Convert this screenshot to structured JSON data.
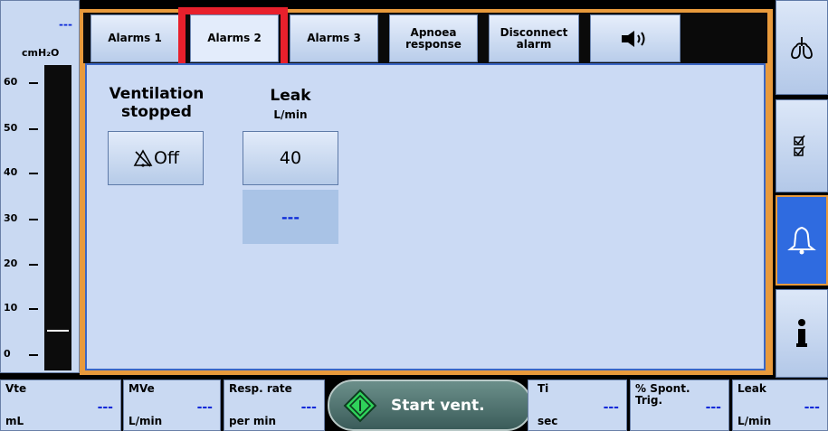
{
  "gauge": {
    "value": "---",
    "unit": "cmH₂O",
    "ticks": [
      "60",
      "50",
      "40",
      "30",
      "20",
      "10",
      "0"
    ],
    "marker_value": 5
  },
  "tabs": [
    {
      "label": "Alarms 1"
    },
    {
      "label": "Alarms 2"
    },
    {
      "label": "Alarms 3"
    },
    {
      "label": "Apnoea response"
    },
    {
      "label": "Disconnect alarm"
    },
    {
      "label": "audio-paused-icon"
    }
  ],
  "active_tab": "Alarms 2",
  "alarms": {
    "ventilation_stopped": {
      "title_line1": "Ventilation",
      "title_line2": "stopped",
      "value": "Off",
      "icon": "alarm-off-icon"
    },
    "leak": {
      "title": "Leak",
      "unit": "L/min",
      "value": "40",
      "measured": "---"
    }
  },
  "sidebar": [
    {
      "icon": "lungs-icon"
    },
    {
      "icon": "checklist-icon"
    },
    {
      "icon": "bell-icon",
      "active": true
    },
    {
      "icon": "info-icon"
    }
  ],
  "bottom_bar": {
    "params": [
      {
        "label": "Vte",
        "unit": "mL",
        "value": "---"
      },
      {
        "label": "MVe",
        "unit": "L/min",
        "value": "---"
      },
      {
        "label": "Resp. rate",
        "unit": "per min",
        "value": "---"
      },
      {
        "label": "Ti",
        "unit": "sec",
        "value": "---"
      },
      {
        "label": "% Spont. Trig.",
        "unit": "",
        "value": "---"
      },
      {
        "label": "Leak",
        "unit": "L/min",
        "value": "---"
      }
    ],
    "start_button": {
      "label": "Start vent.",
      "icon": "start-diamond-icon"
    }
  },
  "colors": {
    "accent_orange": "#e89a3c",
    "highlight_red": "#e8202c",
    "value_blue": "#0a28d8",
    "active_blue": "#2f6be0"
  }
}
